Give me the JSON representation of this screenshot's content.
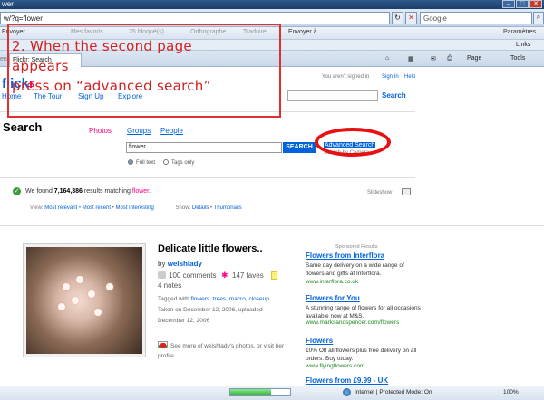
{
  "browser": {
    "title": "wer",
    "address": "w/?q=flower",
    "search_placeholder": "Google",
    "toolbar": [
      "Envoyer",
      "Mes favoris",
      "25 bloqué(s)",
      "Orthographe",
      "Traduire",
      "Envoyer à",
      "Paramètres"
    ],
    "links_label": "Links",
    "tab_label": "Flickr: Search",
    "tab_prefix": "ence",
    "commands": [
      "Page",
      "Tools"
    ],
    "status_zone": "Internet | Protected Mode: On",
    "zoom": "100%",
    "load_progress": 0.68
  },
  "flickr": {
    "logo_a": "flick",
    "logo_b": "r",
    "signed_out": "You aren't signed in",
    "sign_in": "Sign In",
    "help": "Help",
    "nav": [
      "Home",
      "The Tour",
      "Sign Up",
      "Explore"
    ],
    "search_button": "Search",
    "page_title": "Search",
    "tabs": [
      "Photos",
      "Groups",
      "People"
    ],
    "query": "flower",
    "query_button": "SEARCH",
    "advanced": "Advanced Search",
    "camera": "Search by Camera",
    "radio_full": "Full text",
    "radio_tags": "Tags only",
    "found_pre": "We found",
    "found_count": "7,164,386",
    "found_mid": "results matching",
    "found_term": "flower",
    "slideshow": "Slideshow",
    "view_label": "View:",
    "view_opts": [
      "Most relevant",
      "Most recent",
      "Most interesting"
    ],
    "show_label": "Show:",
    "show_opts": [
      "Details",
      "Thumbnails"
    ]
  },
  "result": {
    "title": "Delicate little flowers..",
    "by": "by",
    "user": "welshlady",
    "comments": "100 comments",
    "faves": "147 faves",
    "notes": "4 notes",
    "tagged": "Tagged with",
    "tags": "flowers, trees, macro, closeup ...",
    "taken": "Taken on December 12, 2006, uploaded December 12, 2006",
    "see_more": "See more of welshlady's photos, or visit her profile."
  },
  "ads": {
    "label": "Sponsored Results",
    "items": [
      {
        "title": "Flowers from Interflora",
        "body": "Same day delivery on a wide range of flowers and gifts at Interflora.",
        "url": "www.interflora.co.uk"
      },
      {
        "title": "Flowers for You",
        "body": "A stunning range of flowers for all occasions available now at M&S.",
        "url": "www.marksandspencer.com/flowers"
      },
      {
        "title": "Flowers",
        "body": "10% Off all flowers plus free delivery on all orders. Buy today.",
        "url": "www.flyingflowers.com"
      },
      {
        "title": "Flowers from £9.99 - UK",
        "body": "",
        "url": ""
      }
    ]
  },
  "annotation": {
    "line1": "2. When the second page",
    "line2": "appears",
    "line3": "press on “advanced search”",
    "color": "#e03030"
  }
}
